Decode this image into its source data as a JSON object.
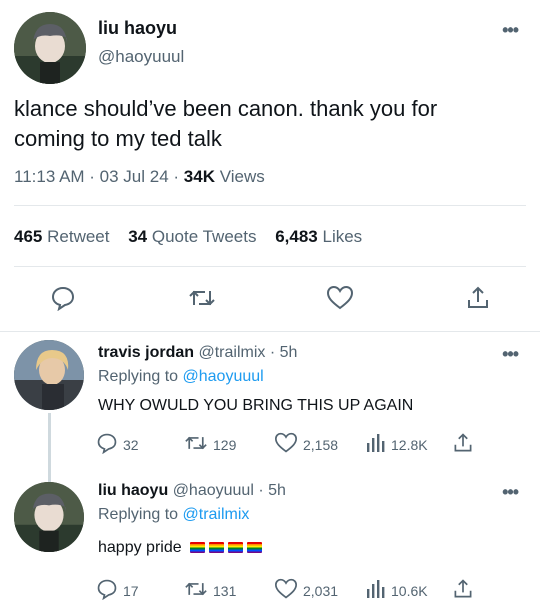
{
  "main_tweet": {
    "display_name": "liu haoyu",
    "handle": "@haoyuuul",
    "text": "klance should’ve been canon. thank you for coming to my ted talk",
    "time": "11:13 AM · 03 Jul 24 · ",
    "views_count": "34K",
    "views_label": " Views",
    "retweets": "465",
    "retweets_label": "Retweet",
    "quotes": "34",
    "quotes_label": "Quote Tweets",
    "likes": "6,483",
    "likes_label": "Likes",
    "more_label": "•••"
  },
  "replies": [
    {
      "display_name": "travis jordan",
      "handle": "@trailmix",
      "time": " · 5h",
      "replying_prefix": "Replying to ",
      "replying_to": "@haoyuuul",
      "text": "WHY OWULD YOU BRING THIS UP AGAIN",
      "reply_count": "32",
      "retweet_count": "129",
      "like_count": "2,158",
      "view_count": "12.8K"
    },
    {
      "display_name": "liu haoyu",
      "handle": "@haoyuuul",
      "time": " · 5h",
      "replying_prefix": "Replying to ",
      "replying_to": "@trailmix",
      "text": "happy pride",
      "flag_count": 4,
      "reply_count": "17",
      "retweet_count": "131",
      "like_count": "2,031",
      "view_count": "10.6K"
    }
  ],
  "icons": {
    "reply": "speech-bubble-icon",
    "retweet": "retweet-arrows-icon",
    "like": "heart-icon",
    "views": "bar-chart-icon",
    "share": "share-upload-icon"
  },
  "colors": {
    "text": "#0f1419",
    "secondary": "#536471",
    "link": "#1d9bf0",
    "divider": "#e4e8eb"
  }
}
